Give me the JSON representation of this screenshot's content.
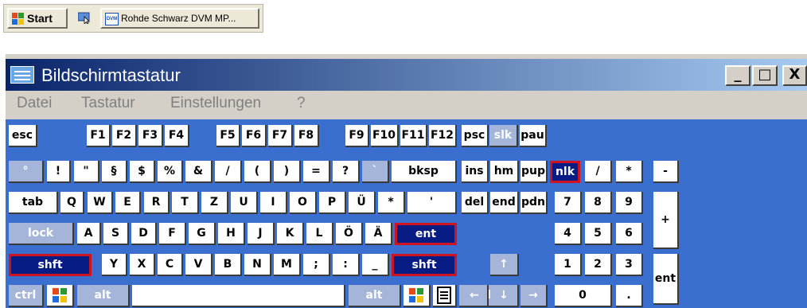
{
  "taskbar": {
    "start_label": "Start",
    "task_label": "Rohde Schwarz DVM MP...",
    "task_icon_text": "DVM"
  },
  "window": {
    "title": "Bildschirmtastatur",
    "buttons": {
      "minimize": "_",
      "maximize": "□",
      "close": "X"
    },
    "menu": [
      "Datei",
      "Tastatur",
      "Einstellungen",
      "?"
    ]
  },
  "keys": {
    "esc": "esc",
    "f1": "F1",
    "f2": "F2",
    "f3": "F3",
    "f4": "F4",
    "f5": "F5",
    "f6": "F6",
    "f7": "F7",
    "f8": "F8",
    "f9": "F9",
    "f10": "F10",
    "f11": "F11",
    "f12": "F12",
    "psc": "psc",
    "slk": "slk",
    "pau": "pau",
    "grave": "°",
    "k1": "!",
    "k2": "\"",
    "k3": "§",
    "k4": "$",
    "k5": "%",
    "k6": "&",
    "k7": "/",
    "k8": "(",
    "k9": ")",
    "k0": "=",
    "sz": "?",
    "acute": "`",
    "bksp": "bksp",
    "ins": "ins",
    "hm": "hm",
    "pup": "pup",
    "nlk": "nlk",
    "numdiv": "/",
    "nummul": "*",
    "numsub": "-",
    "tab": "tab",
    "q": "Q",
    "w": "W",
    "e": "E",
    "r": "R",
    "t": "T",
    "z": "Z",
    "u": "U",
    "i": "I",
    "o": "O",
    "p": "P",
    "ue": "Ü",
    "plus": "*",
    "hash": "'",
    "del": "del",
    "end": "end",
    "pdn": "pdn",
    "n7": "7",
    "n8": "8",
    "n9": "9",
    "numadd": "+",
    "lock": "lock",
    "a": "A",
    "s": "S",
    "d": "D",
    "f": "F",
    "g": "G",
    "h": "H",
    "j": "J",
    "k": "K",
    "l": "L",
    "oe": "Ö",
    "ae": "Ä",
    "ent": "ent",
    "n4": "4",
    "n5": "5",
    "n6": "6",
    "lshift": "shft",
    "lt": ">",
    "y": "Y",
    "x": "X",
    "c": "C",
    "v": "V",
    "b": "B",
    "n": "N",
    "m": "M",
    "comma": ";",
    "period": ":",
    "minus": "_",
    "rshift": "shft",
    "up": "↑",
    "n1": "1",
    "n2": "2",
    "n3": "3",
    "nument": "ent",
    "lctrl": "ctrl",
    "alt": "alt",
    "altgr": "alt",
    "rctrl": "ctrl",
    "left": "←",
    "down": "↓",
    "right": "→",
    "n0": "0",
    "numdot": "."
  }
}
